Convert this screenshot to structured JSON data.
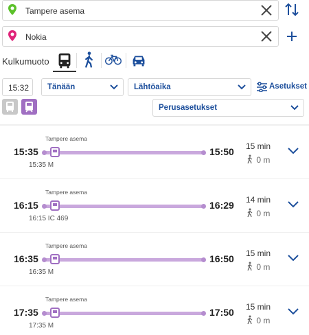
{
  "origin": {
    "value": "Tampere asema"
  },
  "destination": {
    "value": "Nokia"
  },
  "modes": {
    "label": "Kulkumuoto",
    "items": [
      {
        "icon": "bus-icon",
        "selected": true
      },
      {
        "icon": "walk-icon",
        "selected": false
      },
      {
        "icon": "bicycle-icon",
        "selected": false
      },
      {
        "icon": "car-icon",
        "selected": false
      }
    ]
  },
  "time": {
    "value": "15:32"
  },
  "date": {
    "selected": "Tänään"
  },
  "time_type": {
    "selected": "Lähtöaika"
  },
  "settings_link": {
    "label": "Asetukset"
  },
  "preset": {
    "selected": "Perusasetukset"
  },
  "colors": {
    "accent": "#1d4f9c",
    "route": "#c9a8dd",
    "vehicle_active": "#a06fc2"
  },
  "results": [
    {
      "stop": "Tampere asema",
      "dep": "15:35",
      "arr": "15:50",
      "sub": "15:35 M",
      "duration": "15 min",
      "walk": "0 m"
    },
    {
      "stop": "Tampere asema",
      "dep": "16:15",
      "arr": "16:29",
      "sub": "16:15 IC 469",
      "duration": "14 min",
      "walk": "0 m"
    },
    {
      "stop": "Tampere asema",
      "dep": "16:35",
      "arr": "16:50",
      "sub": "16:35 M",
      "duration": "15 min",
      "walk": "0 m"
    },
    {
      "stop": "Tampere asema",
      "dep": "17:35",
      "arr": "17:50",
      "sub": "17:35 M",
      "duration": "15 min",
      "walk": "0 m"
    }
  ]
}
